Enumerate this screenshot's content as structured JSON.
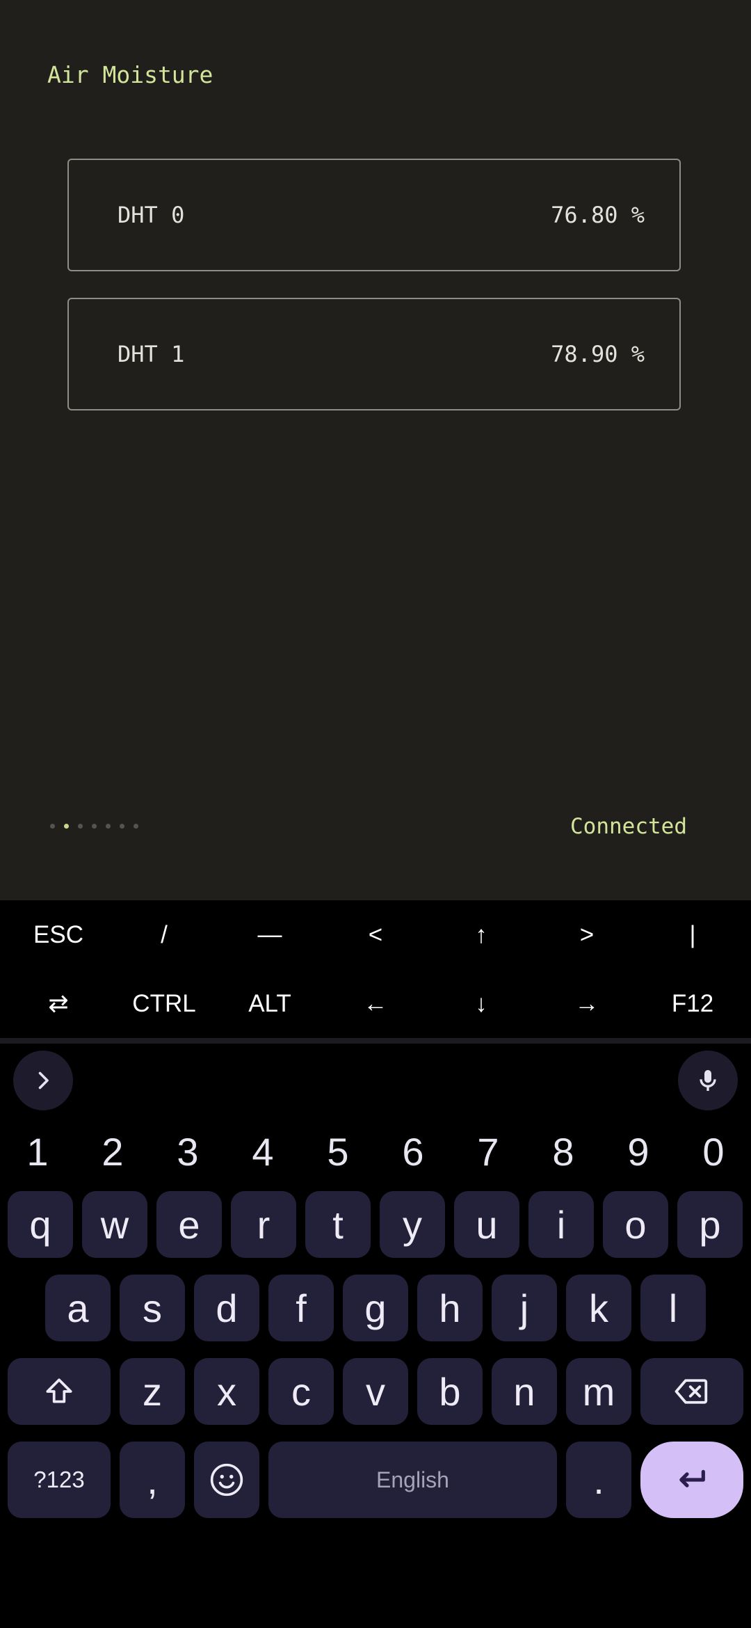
{
  "app": {
    "title": "Air Moisture",
    "sensors": [
      {
        "name": "DHT 0",
        "value": "76.80 %"
      },
      {
        "name": "DHT 1",
        "value": "78.90 %"
      }
    ],
    "pager": {
      "count": 7,
      "active_index": 1
    },
    "status": "Connected"
  },
  "extra_keys": {
    "row1": [
      "ESC",
      "/",
      "—",
      "<",
      "↑",
      ">",
      "|"
    ],
    "row2": [
      "⇄",
      "CTRL",
      "ALT",
      "←",
      "↓",
      "→",
      "F12"
    ]
  },
  "keyboard": {
    "numbers": [
      "1",
      "2",
      "3",
      "4",
      "5",
      "6",
      "7",
      "8",
      "9",
      "0"
    ],
    "row1": [
      "q",
      "w",
      "e",
      "r",
      "t",
      "y",
      "u",
      "i",
      "o",
      "p"
    ],
    "row2": [
      "a",
      "s",
      "d",
      "f",
      "g",
      "h",
      "j",
      "k",
      "l"
    ],
    "row3": [
      "z",
      "x",
      "c",
      "v",
      "b",
      "n",
      "m"
    ],
    "symbols_key": "?123",
    "comma_key": ",",
    "space_label": "English",
    "period_key": ".",
    "enter_color": "#d5bff7",
    "key_color": "#23203a"
  }
}
